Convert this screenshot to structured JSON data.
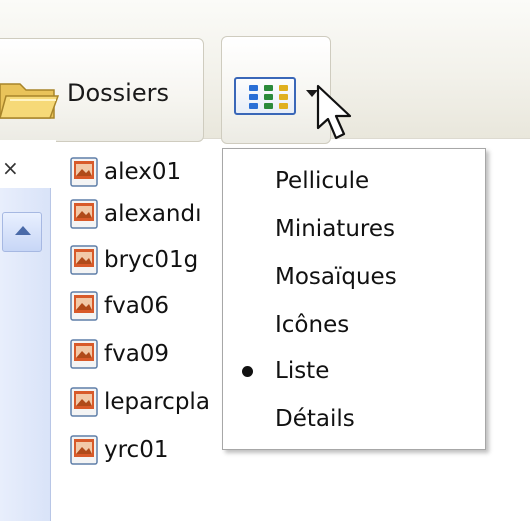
{
  "toolbar": {
    "folders_label": "Dossiers",
    "views_button_icon": "views-grid-icon",
    "views_icon_colors": [
      "#2a6fd6",
      "#2a8a3a",
      "#e0b020",
      "#2a6fd6",
      "#2a8a3a",
      "#e0b020",
      "#2a6fd6",
      "#2a8a3a",
      "#e0b020"
    ]
  },
  "files": {
    "items": [
      {
        "name": "alex01"
      },
      {
        "name": "alexandı"
      },
      {
        "name": "bryc01g"
      },
      {
        "name": "fva06"
      },
      {
        "name": "fva09"
      },
      {
        "name": "leparcpla"
      },
      {
        "name": "yrc01"
      }
    ]
  },
  "view_menu": {
    "items": [
      {
        "label": "Pellicule"
      },
      {
        "label": "Miniatures"
      },
      {
        "label": "Mosaïques"
      },
      {
        "label": "Icônes"
      },
      {
        "label": "Liste"
      },
      {
        "label": "Détails"
      }
    ],
    "selected_index": 4
  },
  "colors": {
    "menu_border": "#a7a7a7",
    "scrollbar": "#d9e3f8",
    "accent": "#3a67b8"
  }
}
